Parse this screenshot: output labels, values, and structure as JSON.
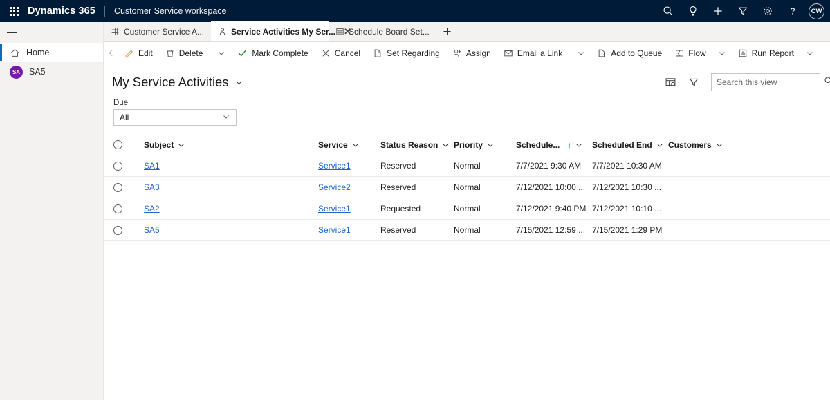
{
  "appbar": {
    "waffle": "app-launcher",
    "brand": "Dynamics 365",
    "app_name": "Customer Service workspace",
    "actions": [
      {
        "name": "search-icon",
        "label": "Search"
      },
      {
        "name": "lightbulb-icon",
        "label": "Assistant"
      },
      {
        "name": "plus-icon",
        "label": "New"
      },
      {
        "name": "filter-icon",
        "label": "Filter"
      },
      {
        "name": "gear-icon",
        "label": "Settings"
      },
      {
        "name": "help-icon",
        "label": "Help"
      }
    ],
    "avatar": {
      "initials": "CW",
      "color": "#ffffff"
    }
  },
  "sidebar": {
    "items": [
      {
        "label": "Home",
        "icon": "home-icon",
        "selected": true
      },
      {
        "label": "SA5",
        "icon": "avatar",
        "initials": "SA",
        "selected": false
      }
    ],
    "avatar_color": "#7719aa"
  },
  "tabs": [
    {
      "label": "Customer Service A...",
      "icon": "dashboard-icon",
      "active": false,
      "closable": false
    },
    {
      "label": "Service Activities My Ser...",
      "icon": "activity-icon",
      "active": true,
      "closable": true
    },
    {
      "label": "Schedule Board Set...",
      "icon": "calendar-icon",
      "active": false,
      "closable": false
    }
  ],
  "tab_add_label": "+",
  "commandbar": {
    "back_label": "Back",
    "items": [
      {
        "label": "Edit",
        "icon": "pencil-icon",
        "type": "button"
      },
      {
        "label": "Delete",
        "icon": "trash-icon",
        "type": "button"
      },
      {
        "label": "",
        "icon": "chevron-down-icon",
        "type": "chevron"
      },
      {
        "label": "Mark Complete",
        "icon": "check-icon",
        "type": "button",
        "color": "#107c10"
      },
      {
        "label": "Cancel",
        "icon": "x-icon",
        "type": "button"
      },
      {
        "label": "Set Regarding",
        "icon": "document-icon",
        "type": "button"
      },
      {
        "label": "Assign",
        "icon": "person-add-icon",
        "type": "button"
      },
      {
        "label": "Email a Link",
        "icon": "email-icon",
        "type": "button"
      },
      {
        "label": "",
        "icon": "chevron-down-icon",
        "type": "chevron"
      },
      {
        "label": "Add to Queue",
        "icon": "queue-icon",
        "type": "button"
      },
      {
        "label": "Flow",
        "icon": "flow-icon",
        "type": "button"
      },
      {
        "label": "",
        "icon": "chevron-down-icon",
        "type": "chevron"
      },
      {
        "label": "Run Report",
        "icon": "report-icon",
        "type": "button"
      },
      {
        "label": "",
        "icon": "chevron-down-icon",
        "type": "chevron"
      }
    ],
    "overflow_label": "⋮"
  },
  "view": {
    "title": "My Service Activities",
    "title_chevron": "chevron-down-icon",
    "edit_columns_icon": "edit-columns-icon",
    "filter_icon": "filter-icon",
    "search": {
      "placeholder": "Search this view",
      "value": "",
      "icon": "search-icon"
    }
  },
  "due_filter": {
    "label": "Due",
    "value": "All",
    "options": [
      "All"
    ]
  },
  "grid": {
    "select_all_label": "Select all rows",
    "columns": [
      {
        "key": "subject",
        "label": "Subject",
        "sorted": false
      },
      {
        "key": "service",
        "label": "Service",
        "sorted": false
      },
      {
        "key": "status",
        "label": "Status Reason",
        "sorted": false
      },
      {
        "key": "priority",
        "label": "Priority",
        "sorted": false
      },
      {
        "key": "start",
        "label": "Schedule...",
        "sorted": true,
        "sort_dir": "↑"
      },
      {
        "key": "end",
        "label": "Scheduled End",
        "sorted": false
      },
      {
        "key": "customers",
        "label": "Customers",
        "sorted": false
      }
    ],
    "rows": [
      {
        "subject": "SA1",
        "service": "Service1",
        "status": "Reserved",
        "priority": "Normal",
        "start": "7/7/2021 9:30 AM",
        "end": "7/7/2021 10:30 AM",
        "customers": ""
      },
      {
        "subject": "SA3",
        "service": "Service2",
        "status": "Reserved",
        "priority": "Normal",
        "start": "7/12/2021 10:00 ...",
        "end": "7/12/2021 10:30 ...",
        "customers": ""
      },
      {
        "subject": "SA2",
        "service": "Service1",
        "status": "Requested",
        "priority": "Normal",
        "start": "7/12/2021 9:40 PM",
        "end": "7/12/2021 10:10 ...",
        "customers": ""
      },
      {
        "subject": "SA5",
        "service": "Service1",
        "status": "Reserved",
        "priority": "Normal",
        "start": "7/15/2021 12:59 ...",
        "end": "7/15/2021 1:29 PM",
        "customers": ""
      }
    ]
  },
  "colors": {
    "appbar_bg": "#001b38",
    "accent": "#0f6cbd",
    "link": "#2266cc",
    "sidebar_bg": "#f3f2f1",
    "avatar_purple": "#7719aa",
    "success_green": "#107c10"
  }
}
